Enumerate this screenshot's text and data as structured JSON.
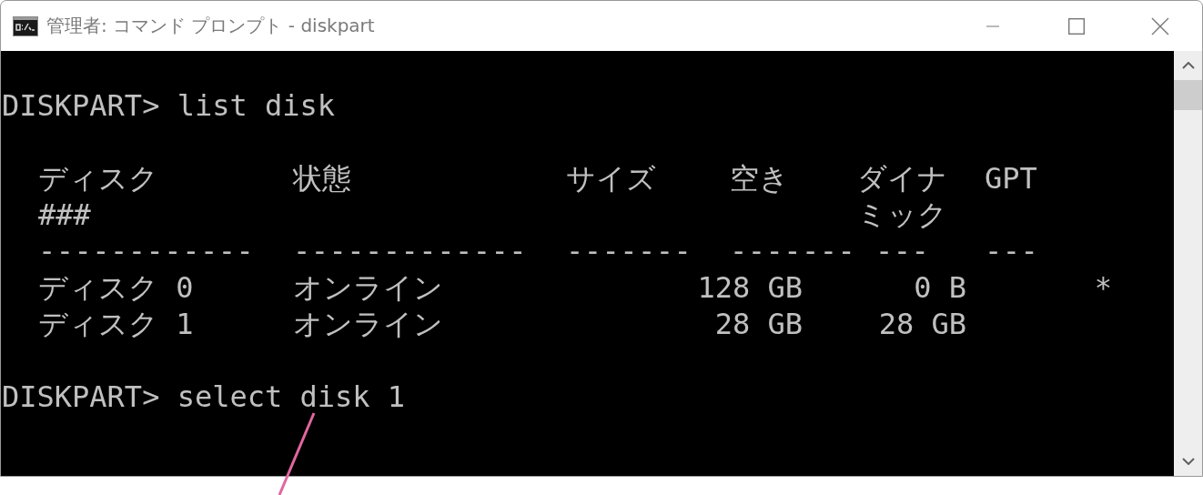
{
  "window": {
    "title": "管理者: コマンド プロンプト - diskpart"
  },
  "console": [
    {
      "kind": "command",
      "text": "DISKPART> list disk"
    },
    {
      "kind": "table",
      "columns": [
        {
          "label": "ディスク",
          "label_2": "###"
        },
        {
          "label": "状態"
        },
        {
          "label": "サイズ"
        },
        {
          "label": "空き"
        },
        {
          "label": "ダイナ",
          "label_2": "ミック"
        },
        {
          "label": "GPT"
        }
      ],
      "separators": [
        "------------",
        "-------------",
        "-------",
        "-------",
        "---",
        "---"
      ],
      "rows": [
        {
          "disk": "ディスク 0",
          "status": "オンライン",
          "size": "128 GB",
          "free": "0 B",
          "gpt": "*"
        },
        {
          "disk": "ディスク 1",
          "status": "オンライン",
          "size": "28 GB",
          "free": "28 GB"
        }
      ]
    },
    {
      "kind": "command",
      "text": "DISKPART> select disk 1"
    }
  ]
}
